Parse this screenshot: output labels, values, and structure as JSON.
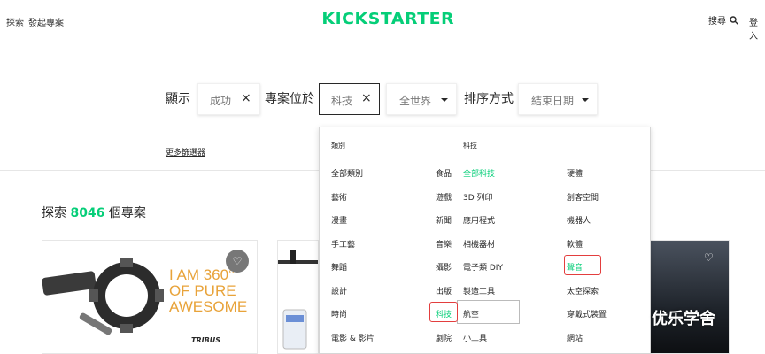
{
  "header": {
    "explore_label": "探索",
    "start_project_label": "發起專案",
    "logo_text": "KICKSTARTER",
    "search_label": "搜尋",
    "login_label": "登入"
  },
  "filter": {
    "show_label": "顯示",
    "status_value": "成功",
    "located_label": "專案位於",
    "category_value": "科技",
    "location_value": "全世界",
    "sort_label": "排序方式",
    "sort_value": "結束日期",
    "more_filters": "更多篩選器"
  },
  "explore": {
    "prefix": "探索",
    "count": "8046",
    "suffix": "個專案"
  },
  "cards": {
    "card1_text": "I AM 360° OF PURE AWESOME",
    "card1_line1": "I AM 360",
    "card1_deg": "°",
    "card1_line2": "OF PURE",
    "card1_line3": "AWESOME",
    "card1_brand": "TRIBUS"
  },
  "dropdown": {
    "left_header": "類別",
    "right_header": "科技",
    "col1": [
      "全部類別",
      "藝術",
      "漫畫",
      "手工藝",
      "舞蹈",
      "設計",
      "時尚",
      "電影 & 影片"
    ],
    "col2": [
      "食品",
      "遊戲",
      "新聞",
      "音樂",
      "攝影",
      "出版",
      "科技",
      "劇院"
    ],
    "col3": [
      "全部科技",
      "3D 列印",
      "應用程式",
      "相機器材",
      "電子類 DIY",
      "製造工具",
      "航空",
      "小工具"
    ],
    "col4": [
      "硬體",
      "創客空間",
      "機器人",
      "軟體",
      "聲音",
      "太空探索",
      "穿戴式裝置",
      "網站"
    ]
  },
  "watermark": "优乐学舍",
  "colors": {
    "brand_green": "#05ce78",
    "highlight_red": "#e33e3e"
  }
}
